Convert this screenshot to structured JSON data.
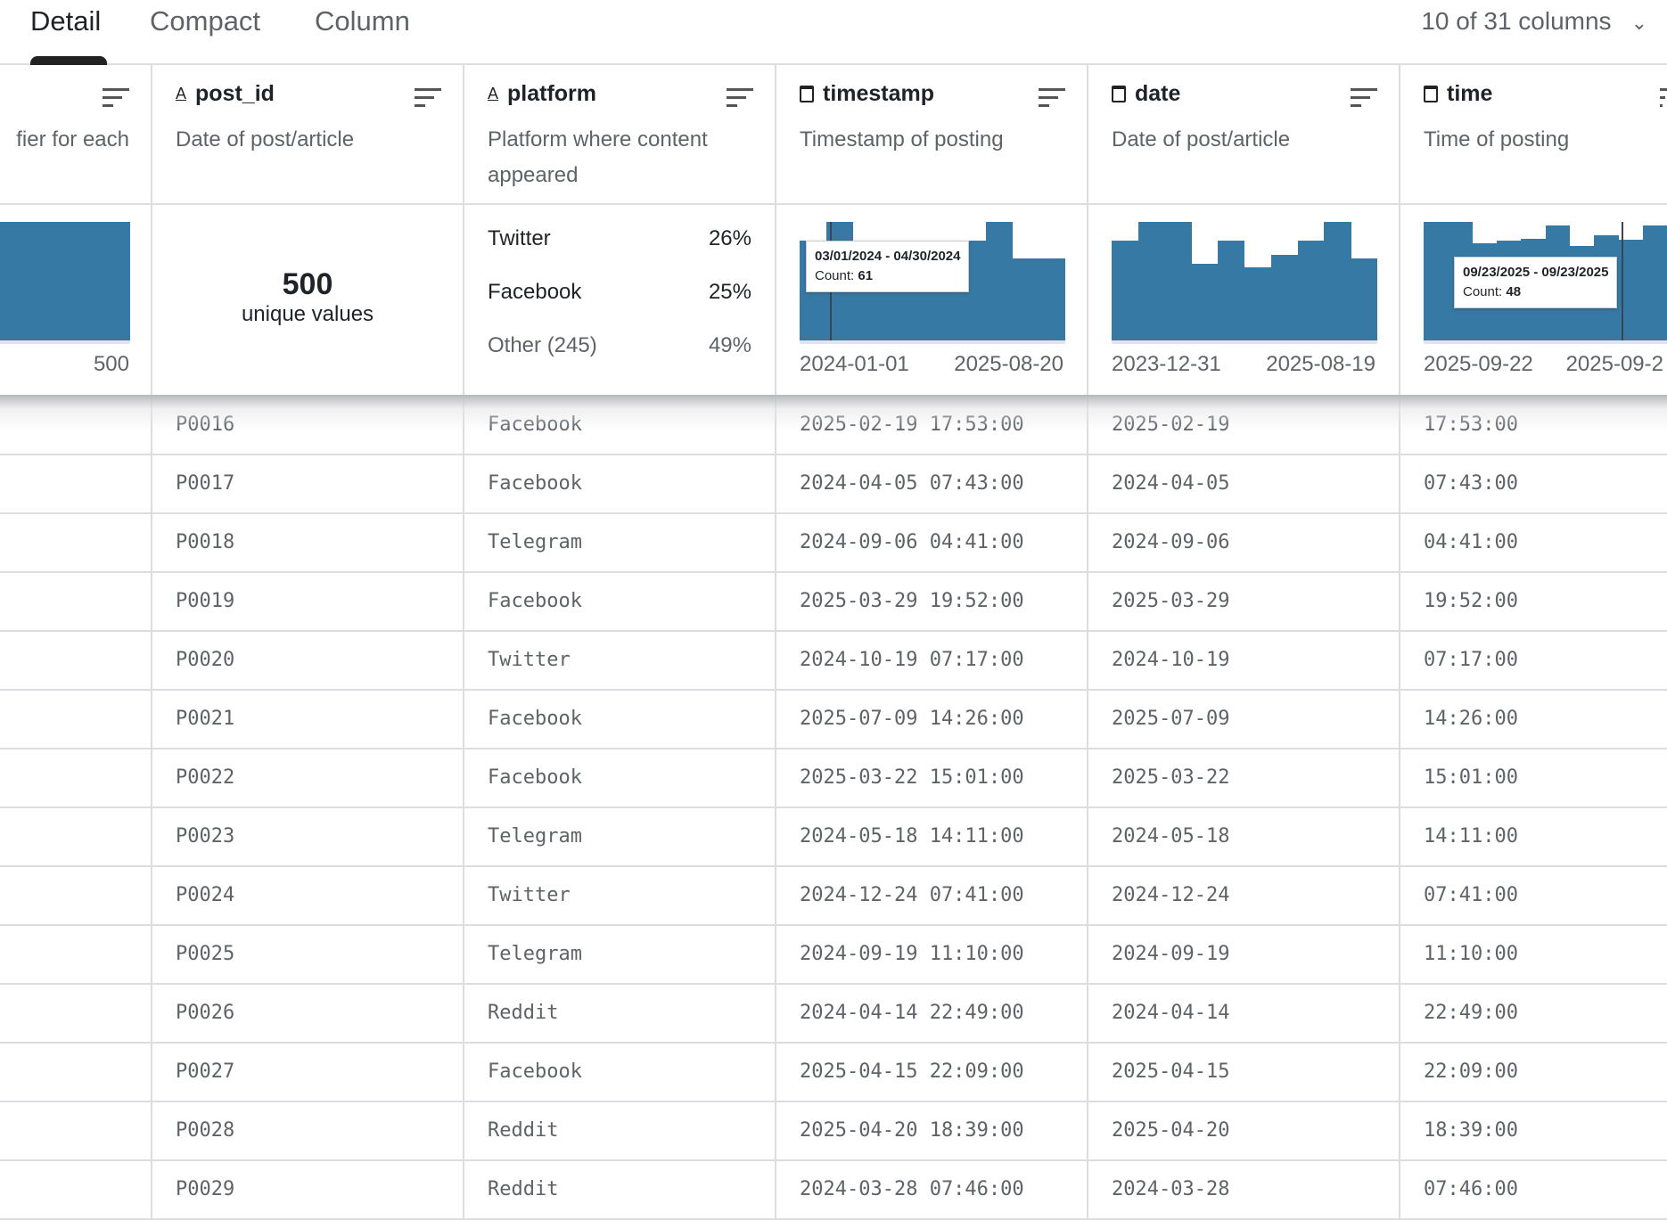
{
  "tabs": [
    {
      "label": "Detail",
      "active": true
    },
    {
      "label": "Compact"
    },
    {
      "label": "Column"
    }
  ],
  "column_selector": {
    "label": "10 of 31 columns",
    "icon": "chevron-down-icon"
  },
  "colors": {
    "bar": "#3679a5"
  },
  "columns": [
    {
      "name": "",
      "type": "",
      "description": "fier for each",
      "summary": {
        "kind": "bar",
        "label": "500"
      }
    },
    {
      "name": "post_id",
      "type": "string",
      "description": "Date of post/article",
      "summary": {
        "kind": "unique",
        "count": "500",
        "label": "unique values"
      }
    },
    {
      "name": "platform",
      "type": "string",
      "description": "Platform where content appeared",
      "summary": {
        "kind": "categories",
        "items": [
          {
            "label": "Twitter",
            "pct": "26%"
          },
          {
            "label": "Facebook",
            "pct": "25%"
          },
          {
            "label": "Other (245)",
            "pct": "49%"
          }
        ]
      }
    },
    {
      "name": "timestamp",
      "type": "date",
      "description": "Timestamp of posting",
      "summary": {
        "kind": "histogram",
        "bins": [
          0.84,
          1.0,
          0.8,
          0.8,
          0.8,
          0.84,
          0.84,
          1.0,
          0.69,
          0.69
        ],
        "min": "2024-01-01",
        "max": "2025-08-20",
        "tooltip": {
          "range": "03/01/2024 - 04/30/2024",
          "count_label": "Count:",
          "count": "61",
          "bin": 1
        }
      }
    },
    {
      "name": "date",
      "type": "date",
      "description": "Date of post/article",
      "summary": {
        "kind": "histogram",
        "bins": [
          0.84,
          1.0,
          1.0,
          0.65,
          0.84,
          0.62,
          0.72,
          0.84,
          1.0,
          0.69
        ],
        "min": "2023-12-31",
        "max": "2025-08-19"
      }
    },
    {
      "name": "time",
      "type": "date",
      "description": "Time of posting",
      "summary": {
        "kind": "histogram",
        "bins": [
          1.0,
          1.0,
          0.82,
          0.84,
          0.86,
          0.97,
          0.8,
          0.89,
          0.85,
          0.97
        ],
        "min": "2025-09-22",
        "max": "2025-09-2",
        "tooltip": {
          "range": "09/23/2025 - 09/23/2025",
          "count_label": "Count:",
          "count": "48",
          "bin": 8
        }
      }
    }
  ],
  "rows": [
    [
      "",
      "P0016",
      "Facebook",
      "2025-02-19 17:53:00",
      "2025-02-19",
      "17:53:00"
    ],
    [
      "",
      "P0017",
      "Facebook",
      "2024-04-05 07:43:00",
      "2024-04-05",
      "07:43:00"
    ],
    [
      "",
      "P0018",
      "Telegram",
      "2024-09-06 04:41:00",
      "2024-09-06",
      "04:41:00"
    ],
    [
      "",
      "P0019",
      "Facebook",
      "2025-03-29 19:52:00",
      "2025-03-29",
      "19:52:00"
    ],
    [
      "",
      "P0020",
      "Twitter",
      "2024-10-19 07:17:00",
      "2024-10-19",
      "07:17:00"
    ],
    [
      "",
      "P0021",
      "Facebook",
      "2025-07-09 14:26:00",
      "2025-07-09",
      "14:26:00"
    ],
    [
      "",
      "P0022",
      "Facebook",
      "2025-03-22 15:01:00",
      "2025-03-22",
      "15:01:00"
    ],
    [
      "",
      "P0023",
      "Telegram",
      "2024-05-18 14:11:00",
      "2024-05-18",
      "14:11:00"
    ],
    [
      "",
      "P0024",
      "Twitter",
      "2024-12-24 07:41:00",
      "2024-12-24",
      "07:41:00"
    ],
    [
      "",
      "P0025",
      "Telegram",
      "2024-09-19 11:10:00",
      "2024-09-19",
      "11:10:00"
    ],
    [
      "",
      "P0026",
      "Reddit",
      "2024-04-14 22:49:00",
      "2024-04-14",
      "22:49:00"
    ],
    [
      "",
      "P0027",
      "Facebook",
      "2025-04-15 22:09:00",
      "2025-04-15",
      "22:09:00"
    ],
    [
      "",
      "P0028",
      "Reddit",
      "2025-04-20 18:39:00",
      "2025-04-20",
      "18:39:00"
    ],
    [
      "",
      "P0029",
      "Reddit",
      "2024-03-28 07:46:00",
      "2024-03-28",
      "07:46:00"
    ]
  ]
}
